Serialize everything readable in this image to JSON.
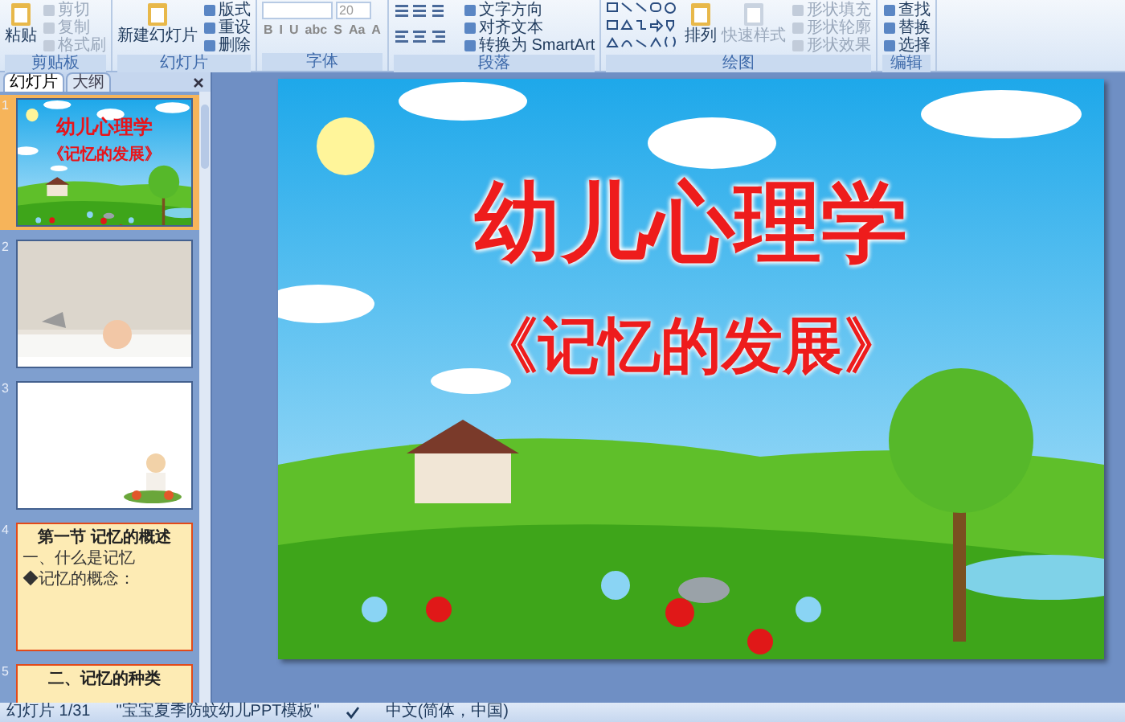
{
  "ribbon": {
    "groups": [
      {
        "label": "剪贴板",
        "large": [
          {
            "label": "粘贴",
            "disabled": false
          }
        ],
        "small": [
          {
            "label": "剪切",
            "disabled": true
          },
          {
            "label": "复制",
            "disabled": true
          },
          {
            "label": "格式刷",
            "disabled": true
          }
        ]
      },
      {
        "label": "幻灯片",
        "large": [
          {
            "label": "新建幻灯片",
            "disabled": false
          }
        ],
        "small": [
          {
            "label": "版式",
            "disabled": false
          },
          {
            "label": "重设",
            "disabled": false
          },
          {
            "label": "删除",
            "disabled": false
          }
        ]
      },
      {
        "label": "字体",
        "kind": "font",
        "font_size": "20",
        "format_buttons": [
          "B",
          "I",
          "U",
          "abc",
          "S",
          "Aa",
          "A"
        ]
      },
      {
        "label": "段落",
        "small": [
          {
            "label": "文字方向",
            "disabled": false
          },
          {
            "label": "对齐文本",
            "disabled": false
          },
          {
            "label": "转换为 SmartArt",
            "disabled": false
          }
        ],
        "kind": "paragraph"
      },
      {
        "label": "绘图",
        "kind": "drawing",
        "large": [
          {
            "label": "排列",
            "disabled": false
          },
          {
            "label": "快速样式",
            "disabled": true
          }
        ],
        "small": [
          {
            "label": "形状填充",
            "disabled": true
          },
          {
            "label": "形状轮廓",
            "disabled": true
          },
          {
            "label": "形状效果",
            "disabled": true
          }
        ]
      },
      {
        "label": "编辑",
        "small": [
          {
            "label": "查找",
            "disabled": false
          },
          {
            "label": "替换",
            "disabled": false
          },
          {
            "label": "选择",
            "disabled": false
          }
        ]
      }
    ]
  },
  "panel_tabs": [
    {
      "label": "幻灯片",
      "selected": true
    },
    {
      "label": "大纲",
      "selected": false
    }
  ],
  "slides": [
    {
      "number": "1",
      "selected": true,
      "kind": "title",
      "title": "幼儿心理学",
      "subtitle": "《记忆的发展》"
    },
    {
      "number": "2",
      "selected": false
    },
    {
      "number": "3",
      "selected": false,
      "kind": "list"
    },
    {
      "number": "4",
      "selected": false,
      "kind": "section",
      "title": "第一节 记忆的概述",
      "lines": [
        "一、什么是记忆",
        "◆记忆的概念："
      ]
    },
    {
      "number": "5",
      "selected": false,
      "kind": "section",
      "title": "二、记忆的种类"
    }
  ],
  "slide": {
    "title": "幼儿心理学",
    "subtitle": "《记忆的发展》"
  },
  "status_bar": {
    "slide": "幻灯片 1/31",
    "theme": "\"宝宝夏季防蚊幼儿PPT模板\"",
    "language": "中文(简体，中国)"
  }
}
